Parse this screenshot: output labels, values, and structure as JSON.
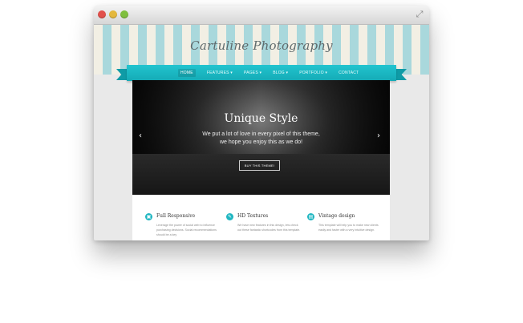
{
  "site": {
    "logo_text": "Cartuline Photography"
  },
  "nav": {
    "items": [
      {
        "label": "HOME",
        "active": true
      },
      {
        "label": "FEATURES ▾",
        "active": false
      },
      {
        "label": "PAGES ▾",
        "active": false
      },
      {
        "label": "BLOG ▾",
        "active": false
      },
      {
        "label": "PORTFOLIO ▾",
        "active": false
      },
      {
        "label": "CONTACT",
        "active": false
      }
    ]
  },
  "slider": {
    "title": "Unique Style",
    "text_line1": "We put a lot of love in every pixel of this theme,",
    "text_line2": "we hope you enjoy this as we do!",
    "button_label": "BUY THIS THEME!",
    "prev_icon": "‹",
    "next_icon": "›"
  },
  "features": [
    {
      "icon": "▣",
      "title": "Full Responsive",
      "text": "Leverage the power of social web to influence purchasing decisions. Social recommendations should be a key"
    },
    {
      "icon": "✎",
      "title": "HD Textures",
      "text": "We have new features in this design, lets check out these fantastic shortcodes from this template."
    },
    {
      "icon": "▤",
      "title": "Vintage design",
      "text": "This template will help you to make new clients easily and faster with a very intuitive design."
    }
  ],
  "colors": {
    "accent": "#1fb6c1",
    "stripe_light": "#f2efe4",
    "stripe_blue": "#a9d8dc"
  }
}
